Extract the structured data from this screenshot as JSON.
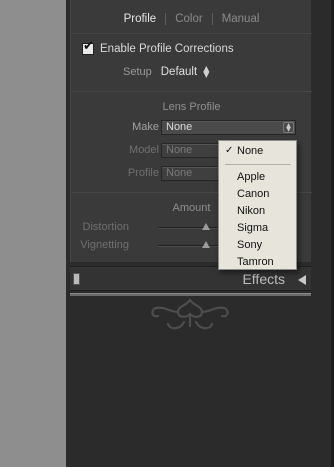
{
  "tabs": [
    {
      "label": "Profile",
      "active": true
    },
    {
      "label": "Color",
      "active": false
    },
    {
      "label": "Manual",
      "active": false
    }
  ],
  "enable_profile": {
    "label": "Enable Profile Corrections",
    "checked": true,
    "check_glyph": "✔"
  },
  "setup": {
    "label": "Setup",
    "value": "Default"
  },
  "lens_profile": {
    "title": "Lens Profile",
    "make": {
      "label": "Make",
      "value": "None"
    },
    "model": {
      "label": "Model",
      "value": "None"
    },
    "profile": {
      "label": "Profile",
      "value": "None"
    }
  },
  "amount": {
    "title": "Amount",
    "distortion": {
      "label": "Distortion"
    },
    "vignetting": {
      "label": "Vignetting"
    }
  },
  "make_dropdown": {
    "selected": "None",
    "check_glyph": "✓",
    "options": [
      "Apple",
      "Canon",
      "Nikon",
      "Sigma",
      "Sony",
      "Tamron"
    ]
  },
  "effects_panel": {
    "label": "Effects"
  },
  "colors": {
    "panel_bg": "#3a3a3a",
    "rail_bg": "#2b2b2b",
    "gutter_bg": "#8e8e8e",
    "popup_bg": "#e7e4dc",
    "active_tab": "#e6e6e6"
  }
}
